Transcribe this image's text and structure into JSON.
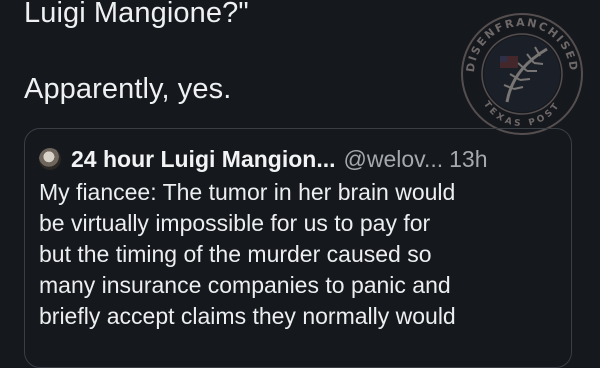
{
  "post": {
    "line1": "Luigi Mangione?\"",
    "line2": "Apparently, yes."
  },
  "watermark": {
    "text": "DISENFRANCHISED",
    "subtext": "TEXAS POST"
  },
  "quote": {
    "display_name": "24 hour Luigi Mangion...",
    "handle": "@welov...",
    "time": "13h",
    "body_lines": [
      "My fiancee: The tumor in her brain would",
      "be virtually impossible for us to pay for",
      "but the timing of the murder caused so",
      "many insurance companies to panic and",
      "briefly accept claims they normally would"
    ]
  }
}
